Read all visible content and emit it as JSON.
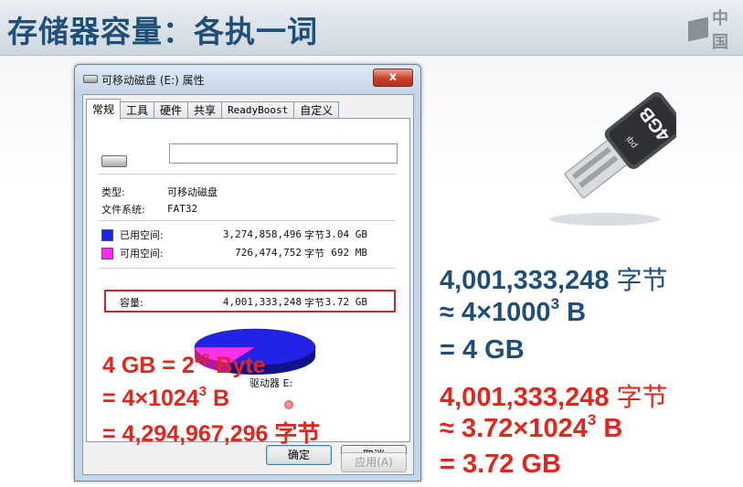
{
  "slide": {
    "title": "存储器容量：各执一词",
    "brand_text": "中国"
  },
  "window": {
    "title": "可移动磁盘 (E:) 属性",
    "close_glyph": "x",
    "tabs": [
      "常规",
      "工具",
      "硬件",
      "共享",
      "ReadyBoost",
      "自定义"
    ],
    "active_tab": "常规",
    "name_field_value": "",
    "type_label": "类型:",
    "type_value": "可移动磁盘",
    "fs_label": "文件系统:",
    "fs_value": "FAT32",
    "used": {
      "label": "已用空间:",
      "bytes": "3,274,858,496",
      "unit": "字节",
      "size": "3.04 GB",
      "color": "#1f24e0"
    },
    "free": {
      "label": "可用空间:",
      "bytes": "726,474,752",
      "unit": "字节",
      "size": "692 MB",
      "color": "#ff2cf0"
    },
    "capacity": {
      "label": "容量:",
      "bytes": "4,001,333,248",
      "unit": "字节",
      "size": "3.72 GB"
    },
    "drive_label": "驱动器 E:",
    "buttons": {
      "ok": "确定",
      "cancel": "取消",
      "apply": "应用(A)"
    }
  },
  "annotation_left": {
    "line1_prefix": "4 GB = 2",
    "line1_exp": "32",
    "line1_suffix": " Byte",
    "line2_prefix": "= 4×1024",
    "line2_exp": "3",
    "line2_suffix": " B",
    "line3": "= 4,294,967,296 字节"
  },
  "usb_image": {
    "label": "4GB",
    "brand": "pqi"
  },
  "annotation_right": {
    "l1": "4,001,333,248",
    "l1_unit": "字节",
    "l2_prefix": "≈ 4×1000",
    "l2_exp": "3",
    "l2_suffix": " B",
    "l3": "= 4 GB",
    "l4": "4,001,333,248",
    "l4_unit": "字节",
    "l5_prefix": "≈ 3.72×1024",
    "l5_exp": "3",
    "l5_suffix": " B",
    "l6": "= 3.72 GB"
  },
  "colors": {
    "title_blue": "#1f4e79",
    "annotation_red": "#e0261d",
    "highlight_box": "#c8282d"
  }
}
